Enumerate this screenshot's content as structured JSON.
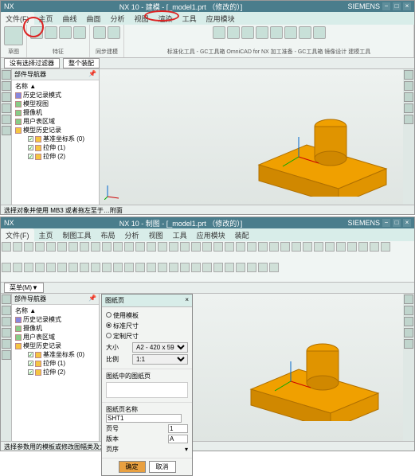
{
  "top": {
    "app": "NX",
    "title": "NX 10 - 建模 - [_model1.prt （修改的）]",
    "brand": "SIEMENS",
    "tabs": [
      "文件(F)",
      "主页",
      "曲线",
      "曲面",
      "分析",
      "视图",
      "渲染",
      "工具",
      "应用模块"
    ],
    "ribbon_groups": [
      "草图",
      "特征",
      "同步建模",
      "标准化工具 - GC工具箱  OmniCAD for NX  加工准备 - GC工具箱  镜像设计  建模工具"
    ],
    "selector": "没有选择过滤器",
    "selector2": "整个装配",
    "tree_title": "部件导航器",
    "tree": {
      "root": "名称 ▲",
      "items": [
        {
          "label": "历史记录模式"
        },
        {
          "label": "模型视图"
        },
        {
          "label": "摄像机"
        },
        {
          "label": "用户表区域"
        },
        {
          "label": "模型历史记录"
        },
        {
          "label": "基准坐标系 (0)",
          "chk": true,
          "indent": 2
        },
        {
          "label": "拉伸 (1)",
          "chk": true,
          "indent": 2
        },
        {
          "label": "拉伸 (2)",
          "chk": true,
          "indent": 2
        }
      ]
    },
    "status": "选择对象并使用 MB3 或者拖左至于…附面"
  },
  "bottom": {
    "title": "NX 10 - 制图 - [_model1.prt （修改的）]",
    "tabs": [
      "文件(F)",
      "主页",
      "制图工具",
      "布局",
      "分析",
      "视图",
      "工具",
      "应用模块",
      "装配"
    ],
    "selector": "菜单(M)▼",
    "status": "选择参数用的模板或修改图幅类及大小设置",
    "dialog": {
      "title": "图纸页",
      "opt1": "使用模板",
      "opt2": "标准尺寸",
      "opt3": "定制尺寸",
      "size_label": "大小",
      "size_value": "A2 - 420 x 594",
      "scale_label": "比例",
      "scale_value": "1:1",
      "name_section": "图纸中的图纸页",
      "name_label": "图纸页名称",
      "name_value": "SHT1",
      "num_label": "页号",
      "num_value": "1",
      "rev_label": "版本",
      "rev_value": "A",
      "seq_label": "页序",
      "ok": "确定",
      "cancel": "取消"
    }
  }
}
